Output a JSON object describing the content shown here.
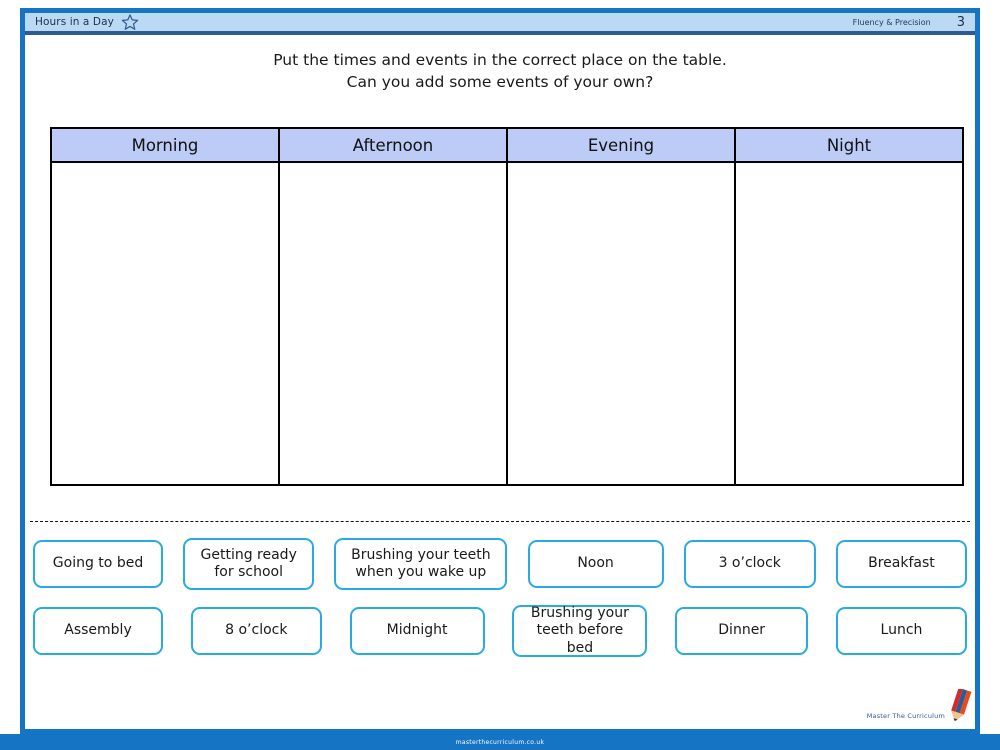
{
  "header": {
    "title": "Hours in a Day",
    "star_icon": "star-outline-icon",
    "subject": "Fluency & Precision",
    "page_number": "3"
  },
  "instructions": {
    "line1": "Put the times and events in the correct place on the table.",
    "line2": "Can you add some events of your own?"
  },
  "table": {
    "columns": [
      {
        "label": "Morning"
      },
      {
        "label": "Afternoon"
      },
      {
        "label": "Evening"
      },
      {
        "label": "Night"
      }
    ],
    "cells": [
      "",
      "",
      "",
      ""
    ]
  },
  "cards": {
    "row1": [
      {
        "label": "Going to bed"
      },
      {
        "label": "Getting ready\nfor school"
      },
      {
        "label": "Brushing your teeth\nwhen you wake up"
      },
      {
        "label": "Noon"
      },
      {
        "label": "3 o’clock"
      },
      {
        "label": "Breakfast"
      }
    ],
    "row2": [
      {
        "label": "Assembly"
      },
      {
        "label": "8 o’clock"
      },
      {
        "label": "Midnight"
      },
      {
        "label": "Brushing your\nteeth before bed"
      },
      {
        "label": "Dinner"
      },
      {
        "label": "Lunch"
      }
    ]
  },
  "brand": {
    "text": "Master The Curriculum",
    "icon": "pencil-icon"
  },
  "footer": {
    "url": "masterthecurriculum.co.uk"
  },
  "colors": {
    "frame_blue": "#1574C4",
    "header_bar": "#BBD9F2",
    "header_rule": "#2E5B95",
    "table_header_fill": "#BDCBF7",
    "card_border": "#29ABE2",
    "text": "#1a1a1a"
  }
}
